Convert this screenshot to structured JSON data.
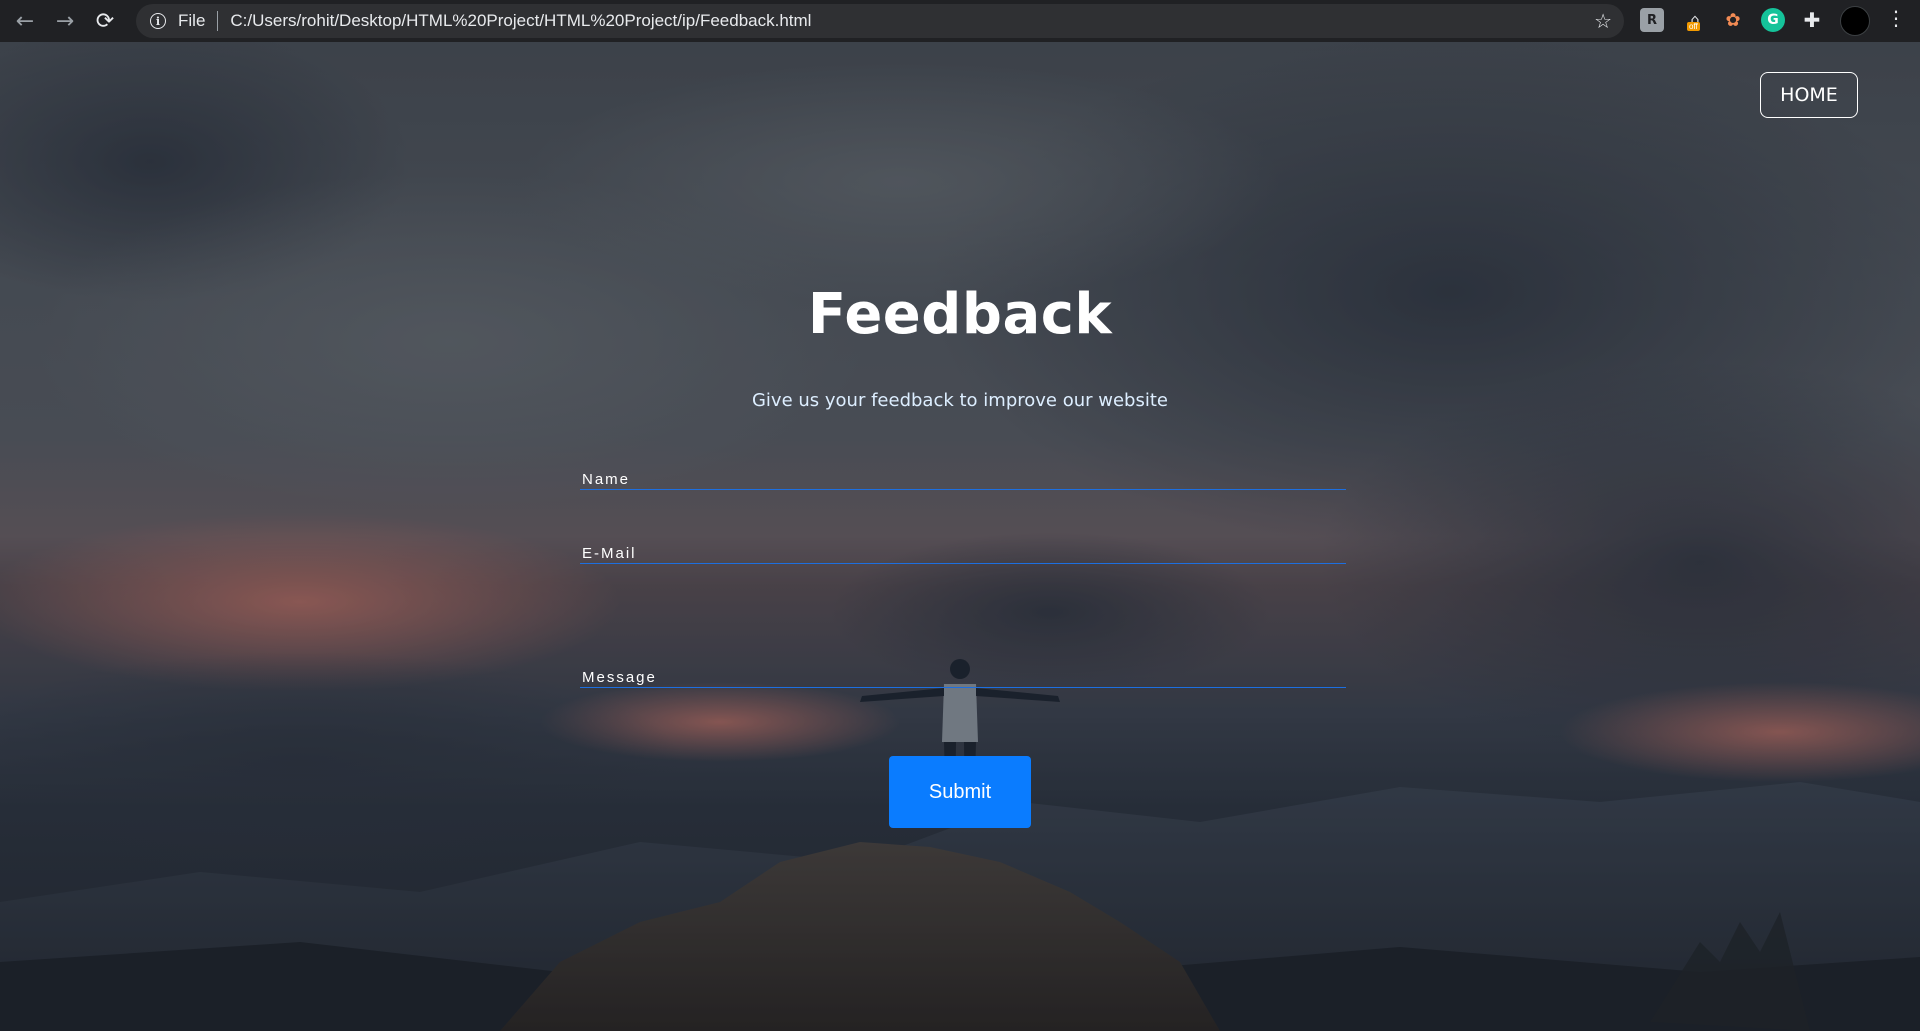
{
  "browser": {
    "back_icon": "←",
    "forward_icon": "→",
    "reload_icon": "⟳",
    "info_icon": "i",
    "scheme": "File",
    "url": "C:/Users/rohit/Desktop/HTML%20Project/HTML%20Project/ip/Feedback.html",
    "star_icon": "☆",
    "ext_badge": "off",
    "menu_icon": "⋮"
  },
  "page": {
    "home_label": "HOME",
    "title": "Feedback",
    "subtitle": "Give us your feedback to improve our website",
    "fields": {
      "name_label": "Name",
      "email_label": "E-Mail",
      "message_label": "Message"
    },
    "submit_label": "Submit"
  },
  "colors": {
    "accent": "#0a7cff",
    "underline": "#1d6fe0"
  }
}
